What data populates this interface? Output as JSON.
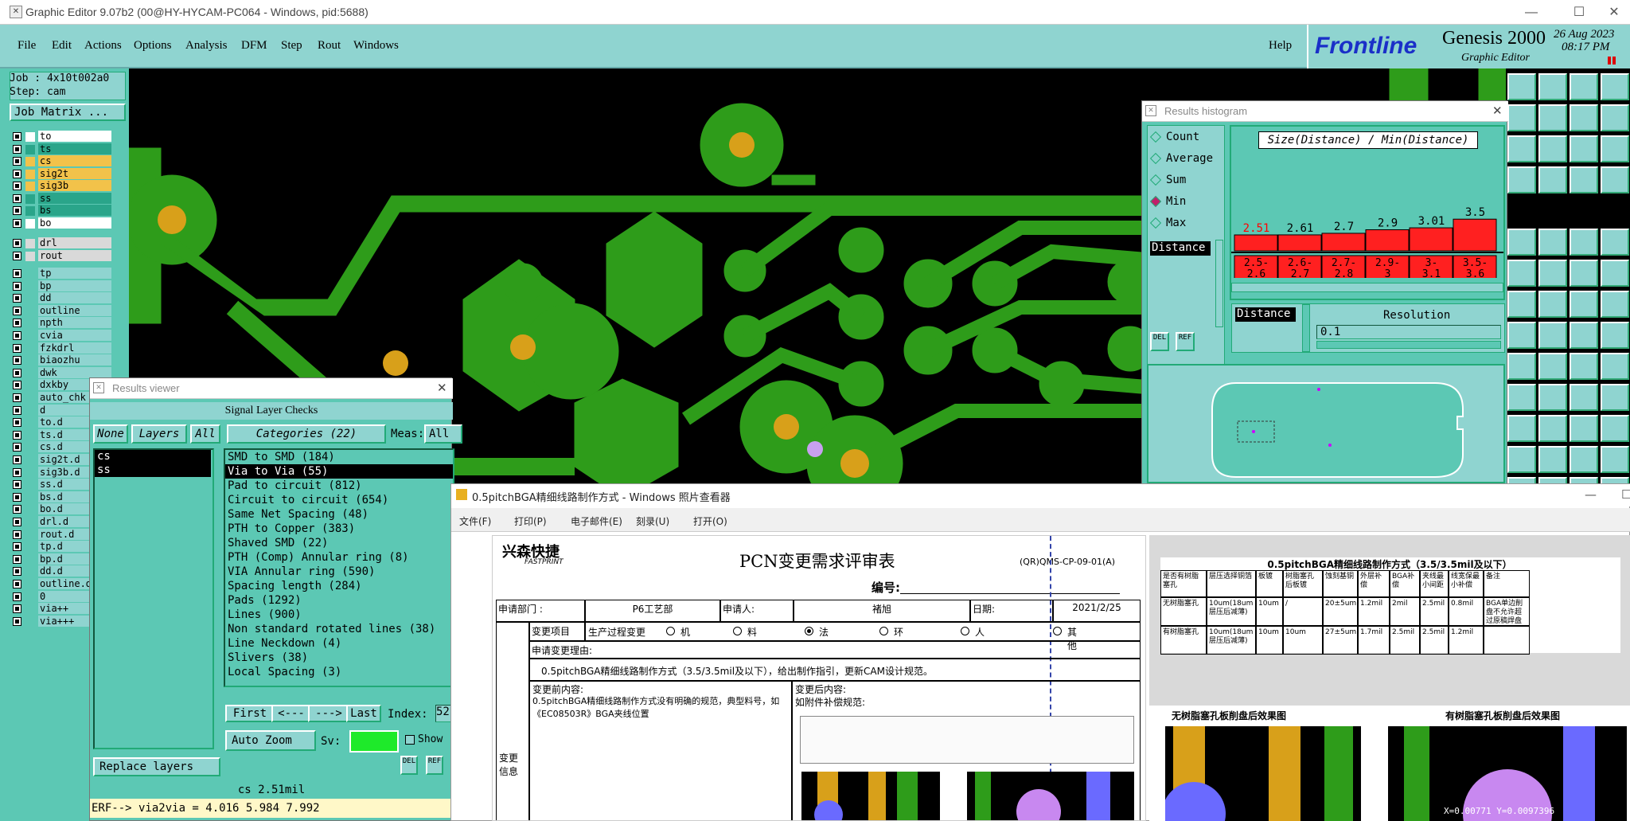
{
  "window": {
    "title": "Graphic Editor 9.07b2 (00@HY-HYCAM-PC064 - Windows, pid:5688)"
  },
  "menu": [
    "File",
    "Edit",
    "Actions",
    "Options",
    "Analysis",
    "DFM",
    "Step",
    "Rout",
    "Windows"
  ],
  "menu_help": "Help",
  "brand": {
    "logo": "Frontline",
    "product": "Genesis 2000",
    "subtitle": "Graphic Editor",
    "date": "26 Aug 2023",
    "time": "08:17 PM"
  },
  "left": {
    "job": "Job : 4x10t002a0",
    "step": "Step: cam",
    "job_matrix": "Job Matrix ...",
    "layers_top": [
      {
        "name": "to",
        "color": "#ffffff"
      },
      {
        "name": "ts",
        "color": "#2aa58a"
      },
      {
        "name": "cs",
        "color": "#f2c24a"
      },
      {
        "name": "sig2t",
        "color": "#f2c24a"
      },
      {
        "name": "sig3b",
        "color": "#f2c24a"
      },
      {
        "name": "ss",
        "color": "#2aa58a"
      },
      {
        "name": "bs",
        "color": "#2aa58a"
      },
      {
        "name": "bo",
        "color": "#ffffff"
      }
    ],
    "layers_drill": [
      {
        "name": "drl",
        "color": "#d9d9d9"
      },
      {
        "name": "rout",
        "color": "#d9d9d9"
      }
    ],
    "layers_misc": [
      "tp",
      "bp",
      "dd",
      "outline",
      "npth",
      "cvia",
      "fzkdrl",
      "biaozhu",
      "dwk",
      "dxkby",
      "auto_chk",
      "d",
      "to.d",
      "ts.d",
      "cs.d",
      "sig2t.d",
      "sig3b.d",
      "ss.d",
      "bs.d",
      "bo.d",
      "drl.d",
      "rout.d",
      "tp.d",
      "bp.d",
      "dd.d",
      "outline.d",
      "0",
      "via++",
      "via+++"
    ]
  },
  "results_viewer": {
    "title": "Results viewer",
    "header": "Signal Layer Checks",
    "none_label": "None",
    "layers_label": "Layers",
    "all_label": "All",
    "categories_label": "Categories (22)",
    "meas_label": "Meas:",
    "meas_value": "All",
    "layers": [
      "cs",
      "ss"
    ],
    "categories": [
      "SMD to SMD (184)",
      "Via to Via (55)",
      "Pad to circuit (812)",
      "Circuit to circuit (654)",
      "Same Net Spacing (48)",
      "PTH to Copper (383)",
      "Shaved SMD (22)",
      "PTH (Comp) Annular ring (8)",
      "VIA Annular ring (590)",
      "Spacing length (284)",
      "Pads (1292)",
      "Lines (900)",
      "Non standard rotated lines (38)",
      "Line Neckdown (4)",
      "Slivers (38)",
      "Local Spacing (3)"
    ],
    "first": "First",
    "prev": "<---",
    "next": "--->",
    "last": "Last",
    "index_label": "Index:",
    "index_value": "52",
    "auto_zoom": "Auto Zoom",
    "sv_label": "Sv:",
    "show_label": "Show",
    "replace_layers": "Replace layers",
    "del": "DEL",
    "ref": "REF",
    "status": "cs 2.51mil",
    "erf": "ERF--> via2via = 4.016 5.984 7.992"
  },
  "histogram": {
    "title": "Results histogram",
    "options": [
      "Count",
      "Average",
      "Sum",
      "Min",
      "Max"
    ],
    "selected_option": "Min",
    "chart_title": "Size(Distance) / Min(Distance)",
    "distance_label": "Distance",
    "resolution_label": "Resolution",
    "resolution_value": "0.1",
    "del": "DEL",
    "ref": "REF"
  },
  "chart_data": {
    "type": "bar",
    "title": "Size(Distance) / Min(Distance)",
    "categories": [
      "2.5-2.6",
      "2.6-2.7",
      "2.7-2.8",
      "2.9-3",
      "3-3.1",
      "3.5-3.6"
    ],
    "values": [
      2.51,
      2.61,
      2.7,
      2.9,
      3.01,
      3.5
    ],
    "value_labels": [
      "2.51",
      "2.61",
      "2.7",
      "2.9",
      "3.01",
      "3.5"
    ],
    "category_labels": [
      [
        "2.5-",
        "2.6"
      ],
      [
        "2.6-",
        "2.7"
      ],
      [
        "2.7-",
        "2.8"
      ],
      [
        "2.9-",
        "3"
      ],
      [
        "3-",
        "3.1"
      ],
      [
        "3.5-",
        "3.6"
      ]
    ],
    "ylim": [
      0,
      3.6
    ],
    "bar_color": "#ff2020"
  },
  "photo_viewer": {
    "title": "0.5pitchBGA精细线路制作方式 - Windows 照片查看器",
    "menu": [
      "文件(F)",
      "打印(P)",
      "电子邮件(E)",
      "刻录(U)",
      "打开(O)"
    ]
  },
  "doc": {
    "company_cn": "兴森快捷",
    "company_en": "FASTPRINT",
    "title": "PCN变更需求评审表",
    "code": "(QR)QMS-CP-09-01(A)",
    "num_label": "编号:",
    "dept_label": "申请部门 :",
    "dept_value": "P6工艺部",
    "applicant_label": "申请人:",
    "applicant_value": "褚旭",
    "date_label": "日期:",
    "date_value": "2021/2/25",
    "change_item": "变更项目",
    "change_type": "生产过程变更",
    "opt_machine": "机",
    "opt_material": "料",
    "opt_method": "法",
    "opt_env": "环",
    "opt_man": "人",
    "opt_other": "其他",
    "reason_label": "申请变更理由:",
    "reason": "0.5pitchBGA精细线路制作方式（3.5/3.5mil及以下），给出制作指引，更新CAM设计规范。",
    "before_label": "变更前内容:",
    "before": "0.5pitchBGA精细线路制作方式没有明确的规范，典型料号，如《EC08503R》BGA夹线位置",
    "after_label": "变更后内容:",
    "after": "如附件补偿规范:",
    "change_info": "变更信息"
  },
  "doc2": {
    "table_title": "0.5pitchBGA精细线路制作方式（3.5/3.5mil及以下）",
    "headers": [
      "是否有树脂塞孔",
      "层压选择铜箔",
      "板镀",
      "树脂塞孔后板镀",
      "蚀刻基铜",
      "外层补偿",
      "BGA补偿",
      "夹线最小间距",
      "线宽保最小补偿",
      "备注"
    ],
    "rows": [
      [
        "无树脂塞孔",
        "10um(18um层压后减薄)",
        "10um",
        "/",
        "20±5um",
        "1.2mil",
        "2mil",
        "2.5mil",
        "0.8mil",
        "BGA单边削盘不允许超过原稿焊盘0.2mil"
      ],
      [
        "有树脂塞孔",
        "10um(18um层压后减薄)",
        "10um",
        "10um",
        "27±5um",
        "1.7mil",
        "2.5mil",
        "2.5mil",
        "1.2mil",
        ""
      ]
    ],
    "img1_label": "无树脂塞孔板削盘后效果图",
    "img2_label": "有树脂塞孔板削盘后效果图",
    "coords": "X=0.00771 Y=0.0097396"
  }
}
